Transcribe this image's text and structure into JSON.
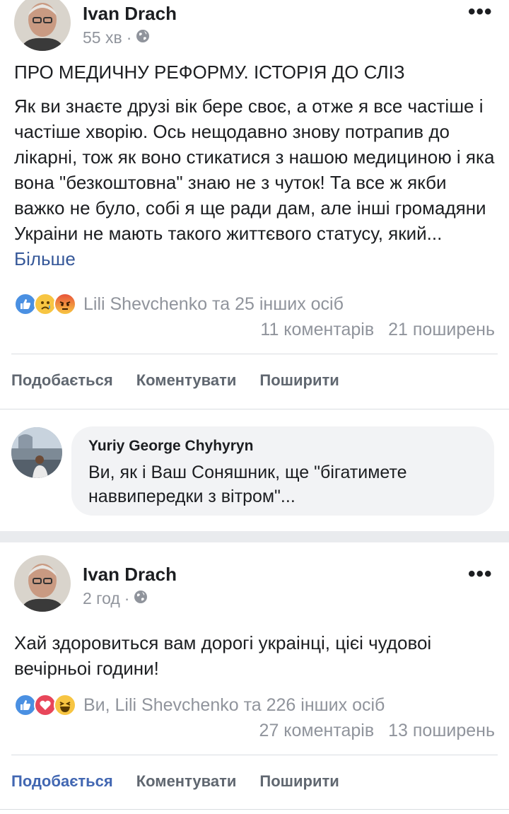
{
  "post1": {
    "author": "Ivan Drach",
    "time": "55 хв",
    "separator": "·",
    "title": "ПРО МЕДИЧНУ РЕФОРМУ. ІСТОРІЯ ДО СЛІЗ",
    "body": "Як ви знаєте друзі вік бере своє, а отже я все частіше і частіше хворію. Ось нещодавно знову потрапив до лікарні, тож як воно стикатися з нашою медициною і яка вона \"безкоштовна\" знаю не з чуток! Та все ж якби важко не було, собі я ще ради дам, але інші громадяни Украіни не мають такого життєвого статусу, який...",
    "see_more": "Більше",
    "reactions": [
      "like-icon",
      "sad-icon",
      "angry-icon"
    ],
    "reaction_names": "Lili Shevchenko та 25 інших осіб",
    "comments": "11 коментарів",
    "shares": "21 поширень",
    "actions": {
      "like": "Подобається",
      "comment": "Коментувати",
      "share": "Поширити"
    },
    "comment": {
      "author": "Yuriy George Chyhyryn",
      "text": "Ви, як і Ваш Соняшник, ще \"бігатимете наввипередки з вітром\"..."
    }
  },
  "post2": {
    "author": "Ivan Drach",
    "time": "2 год",
    "separator": "·",
    "body": "Хай здоровиться вам дорогі украінці, цієі чудовоі вечірньоі години!",
    "reactions": [
      "like-icon",
      "love-icon",
      "haha-icon"
    ],
    "reaction_names": "Ви, Lili Shevchenko та 226 інших осіб",
    "comments": "27 коментарів",
    "shares": "13 поширень",
    "actions": {
      "like": "Подобається",
      "comment": "Коментувати",
      "share": "Поширити"
    },
    "like_active": true
  },
  "colors": {
    "link": "#365899",
    "like_blue": "#4267b2",
    "muted": "#90949c",
    "action": "#606770"
  }
}
